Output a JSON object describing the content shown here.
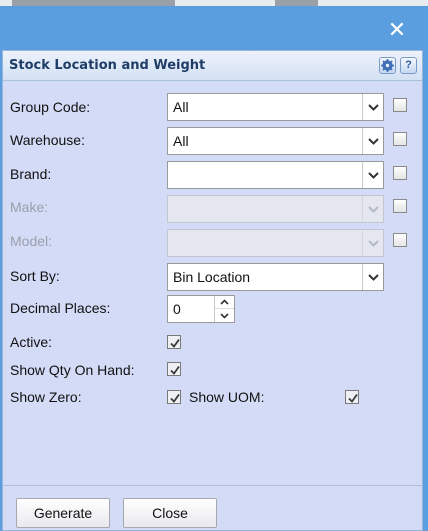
{
  "dialog": {
    "title": "Stock Location and Weight",
    "close_icon": "close-icon",
    "header_icons": [
      "gear-icon",
      "help-icon"
    ],
    "help_glyph": "?"
  },
  "form": {
    "group_code": {
      "label": "Group Code:",
      "value": "All",
      "checked": false,
      "enabled": true
    },
    "warehouse": {
      "label": "Warehouse:",
      "value": "All",
      "checked": false,
      "enabled": true
    },
    "brand": {
      "label": "Brand:",
      "value": "",
      "checked": false,
      "enabled": true
    },
    "make": {
      "label": "Make:",
      "value": "",
      "checked": false,
      "enabled": false
    },
    "model": {
      "label": "Model:",
      "value": "",
      "checked": false,
      "enabled": false
    },
    "sort_by": {
      "label": "Sort By:",
      "value": "Bin Location"
    },
    "decimal_places": {
      "label": "Decimal Places:",
      "value": "0"
    },
    "active": {
      "label": "Active:",
      "checked": true
    },
    "show_qty_on_hand": {
      "label": "Show Qty On Hand:",
      "checked": true
    },
    "show_zero": {
      "label": "Show Zero:",
      "checked": true
    },
    "show_uom": {
      "label": "Show UOM:",
      "checked": true
    }
  },
  "buttons": {
    "generate": "Generate",
    "close": "Close"
  },
  "colors": {
    "title_bar": "#5b9ee0",
    "panel_bg": "#d4dbf7",
    "title_text": "#1f3d66",
    "disabled_text": "#9a9fab"
  }
}
